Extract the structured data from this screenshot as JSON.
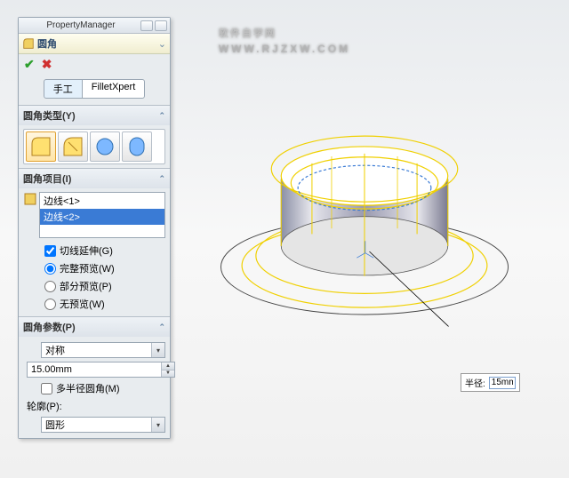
{
  "panel": {
    "title": "PropertyManager",
    "feature_name": "圆角",
    "tabs": {
      "manual": "手工",
      "fxpert": "FilletXpert"
    },
    "sections": {
      "type": {
        "title": "圆角类型(Y)"
      },
      "items": {
        "title": "圆角项目(I)",
        "edges": [
          "边线<1>",
          "边线<2>"
        ],
        "tangent": "切线延伸(G)",
        "full_preview": "完整预览(W)",
        "partial_preview": "部分预览(P)",
        "no_preview": "无预览(W)"
      },
      "params": {
        "title": "圆角参数(P)",
        "symmetry": "对称",
        "radius_value": "15.00mm",
        "multi_radius": "多半径圆角(M)",
        "profile_label": "轮廓(P):",
        "profile_value": "圆形"
      }
    }
  },
  "callout": {
    "label": "半径:",
    "value": "15mm"
  },
  "watermark": {
    "main": "软件自学网",
    "sub": "WWW.RJZXW.COM"
  }
}
